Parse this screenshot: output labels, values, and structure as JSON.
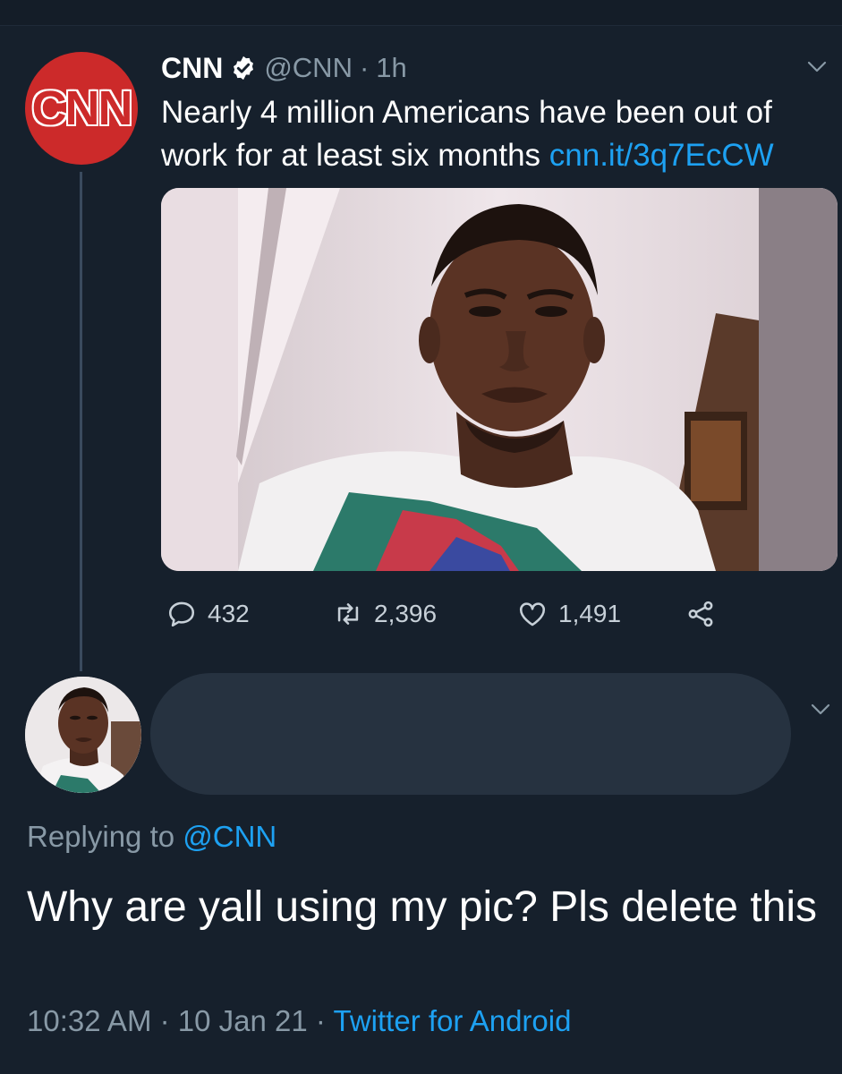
{
  "tweet": {
    "author": {
      "name": "CNN",
      "handle": "@CNN",
      "logo_text": "CNN",
      "verified": true
    },
    "separator": "·",
    "time_ago": "1h",
    "text": "Nearly 4 million Americans have been out of work for at least six months ",
    "link": "cnn.it/3q7EcCW",
    "actions": {
      "replies": "432",
      "retweets": "2,396",
      "likes": "1,491"
    },
    "icons": [
      "verified-badge-icon",
      "chevron-down-icon",
      "reply-icon",
      "retweet-icon",
      "like-icon",
      "share-icon"
    ]
  },
  "reply": {
    "replying_label": "Replying to ",
    "replying_to": "@CNN",
    "text": "Why are yall using my pic? Pls delete this",
    "time": "10:32 AM",
    "separator": "·",
    "date": "10 Jan 21",
    "source": "Twitter for Android"
  },
  "colors": {
    "background": "#16202c",
    "link": "#1da1f2",
    "muted": "#8899a6",
    "cnn_red": "#cc2a2a"
  }
}
